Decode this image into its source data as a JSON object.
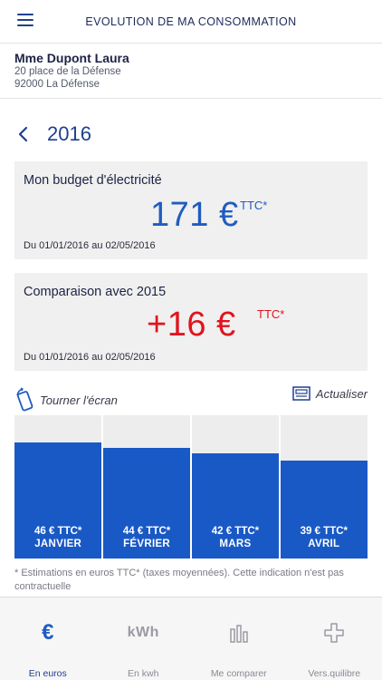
{
  "header": {
    "title": "EVOLUTION DE MA CONSOMMATION"
  },
  "customer": {
    "name": "Mme Dupont Laura",
    "address_line1": "20 place de la Défense",
    "address_line2": "92000 La Défense"
  },
  "year_nav": {
    "year": "2016"
  },
  "budget": {
    "title": "Mon budget d'électricité",
    "amount": "171 €",
    "suffix": "TTC*",
    "period": "Du 01/01/2016 au 02/05/2016"
  },
  "comparison": {
    "title": "Comparaison avec 2015",
    "amount": "+16 €",
    "suffix": "TTC*",
    "period": "Du 01/01/2016 au 02/05/2016"
  },
  "actions": {
    "rotate_label": "Tourner l'écran",
    "refresh_label": "Actualiser"
  },
  "chart_data": {
    "type": "bar",
    "categories": [
      "JANVIER",
      "FÉVRIER",
      "MARS",
      "AVRIL"
    ],
    "values": [
      46,
      44,
      42,
      39
    ],
    "value_labels": [
      "46 € TTC*",
      "44 € TTC*",
      "42 € TTC*",
      "39 € TTC*"
    ],
    "unit": "€ TTC*",
    "ylim": [
      0,
      57
    ]
  },
  "footnote": "* Estimations en euros TTC* (taxes moyennées). Cette indication n'est pas contractuelle",
  "tabs": [
    {
      "label": "En euros",
      "icon": "euro-icon",
      "active": true
    },
    {
      "label": "En kwh",
      "icon": "kwh-icon",
      "active": false,
      "glyph": "kWh"
    },
    {
      "label": "Me comparer",
      "icon": "bar-chart-icon",
      "active": false
    },
    {
      "label": "Vers.quilibre",
      "icon": "plus-icon",
      "active": false
    }
  ],
  "colors": {
    "primary_blue": "#1f5cbf",
    "bar_blue": "#1959c6",
    "positive_red": "#e0141e",
    "card_gray": "#f0f0f0"
  }
}
